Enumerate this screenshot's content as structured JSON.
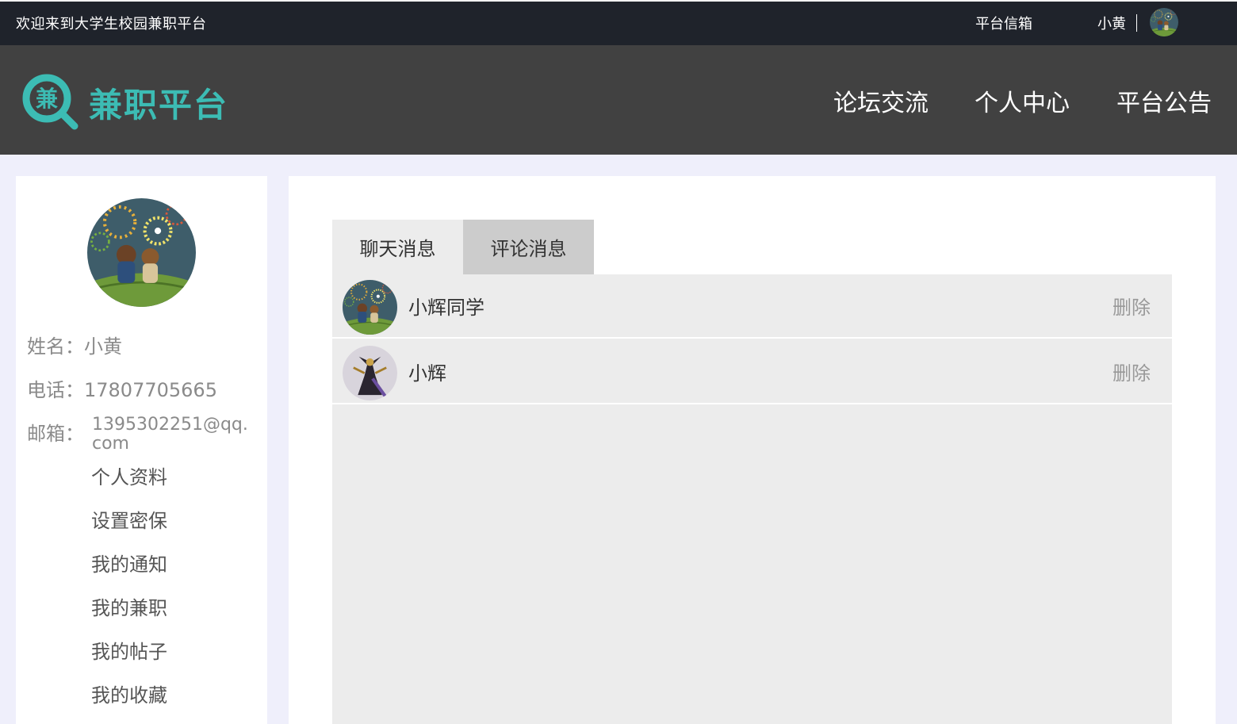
{
  "topbar": {
    "welcome": "欢迎来到大学生校园兼职平台",
    "mailbox": "平台信箱",
    "username": "小黄"
  },
  "header": {
    "logo_char": "兼",
    "brand": "兼职平台",
    "nav": [
      "论坛交流",
      "个人中心",
      "平台公告"
    ]
  },
  "profile": {
    "name_label": "姓名：",
    "name": "小黄",
    "phone_label": "电话：",
    "phone": "17807705665",
    "email_label": "邮箱：",
    "email": "1395302251@qq.com",
    "menu": [
      "个人资料",
      "设置密保",
      "我的通知",
      "我的兼职",
      "我的帖子",
      "我的收藏"
    ]
  },
  "tabs": {
    "chat": "聊天消息",
    "comment": "评论消息"
  },
  "messages": [
    {
      "name": "小辉同学",
      "delete": "删除",
      "avatar": "fireworks-avatar"
    },
    {
      "name": "小辉",
      "delete": "删除",
      "avatar": "warrior-avatar"
    }
  ],
  "colors": {
    "topbar": "#1f232b",
    "header": "#414141",
    "brand": "#3cbcb4",
    "page_bg": "#efeffb",
    "list_bg": "#ececec",
    "active_tab": "#cccccc"
  }
}
